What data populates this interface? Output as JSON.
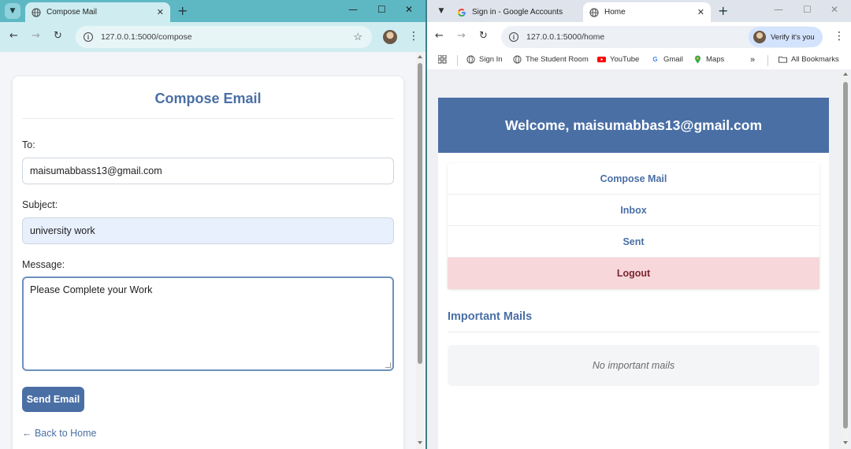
{
  "left_window": {
    "tab": {
      "title": "Compose Mail"
    },
    "address": "127.0.0.1:5000/compose",
    "page": {
      "title": "Compose Email",
      "to_label": "To:",
      "to_value": "maisumabbass13@gmail.com",
      "subject_label": "Subject:",
      "subject_value": "university work",
      "message_label": "Message:",
      "message_value": "Please Complete your Work",
      "send_label": "Send Email",
      "back_label": "← Back to Home"
    }
  },
  "right_window": {
    "tabs": [
      {
        "title": "Sign in - Google Accounts"
      },
      {
        "title": "Home"
      }
    ],
    "address": "127.0.0.1:5000/home",
    "verify_label": "Verify it's you",
    "bookmarks": [
      {
        "label": "Sign In",
        "icon": "globe-icon"
      },
      {
        "label": "The Student Room",
        "icon": "globe-icon"
      },
      {
        "label": "YouTube",
        "icon": "youtube-icon"
      },
      {
        "label": "Gmail",
        "icon": "google-icon"
      },
      {
        "label": "Maps",
        "icon": "maps-icon"
      }
    ],
    "all_bookmarks_label": "All Bookmarks",
    "page": {
      "welcome": "Welcome, maisumabbas13@gmail.com",
      "menu": [
        {
          "label": "Compose Mail"
        },
        {
          "label": "Inbox"
        },
        {
          "label": "Sent"
        },
        {
          "label": "Logout"
        }
      ],
      "important_title": "Important Mails",
      "empty_message": "No important mails"
    }
  },
  "colors": {
    "primary": "#4a6fa5",
    "logout_bg": "#f7d7da",
    "left_chrome": "#5eb8c4",
    "right_chrome": "#dfe4ec"
  }
}
